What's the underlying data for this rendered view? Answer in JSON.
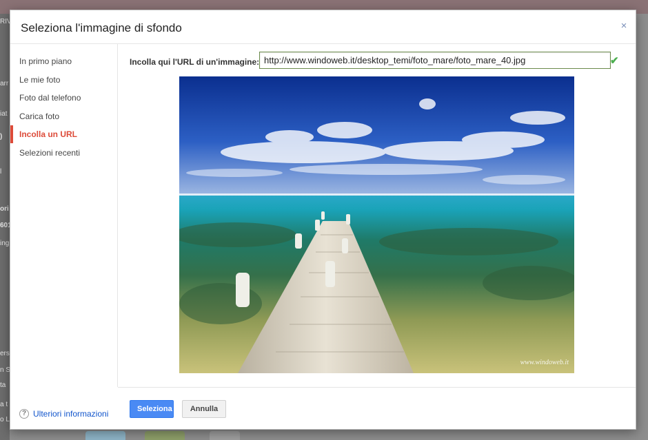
{
  "dialog": {
    "title": "Seleziona l'immagine di sfondo",
    "close_symbol": "×"
  },
  "sidebar": {
    "items": [
      {
        "label": "In primo piano",
        "active": false
      },
      {
        "label": "Le mie foto",
        "active": false
      },
      {
        "label": "Foto dal telefono",
        "active": false
      },
      {
        "label": "Carica foto",
        "active": false
      },
      {
        "label": "Incolla un URL",
        "active": true
      },
      {
        "label": "Selezioni recenti",
        "active": false
      }
    ],
    "help_label": "Ulteriori informazioni",
    "help_icon": "?"
  },
  "main": {
    "url_label": "Incolla qui l'URL di un'immagine:",
    "url_value": "http://www.windoweb.it/desktop_temi/foto_mare/foto_mare_40.jpg",
    "check_icon": "✔",
    "watermark": "www.windoweb.it"
  },
  "footer": {
    "select_label": "Seleziona",
    "cancel_label": "Annulla"
  },
  "background_fragments": [
    "RIV",
    "arr",
    "iat",
    ")",
    "l",
    "ori",
    "601",
    "ing",
    "ers",
    "n S",
    "ta",
    "a t",
    "o L"
  ],
  "colors": {
    "accent_red": "#dd4b39",
    "primary_blue": "#4a8af4",
    "link_blue": "#1155cc",
    "check_green": "#4caf50"
  },
  "icons": [
    "close-icon",
    "check-icon",
    "help-icon"
  ]
}
